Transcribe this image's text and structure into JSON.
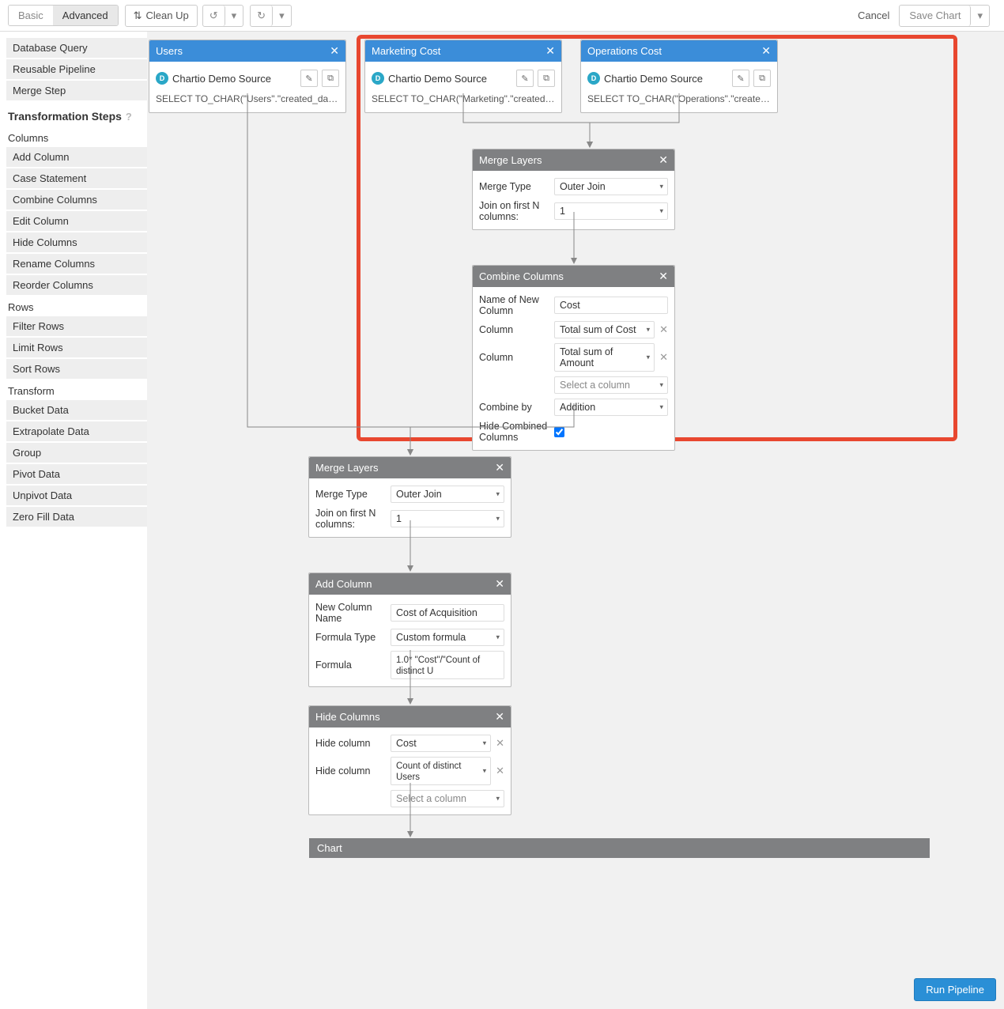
{
  "toolbar": {
    "basic": "Basic",
    "advanced": "Advanced",
    "cleanup": "Clean Up",
    "cancel": "Cancel",
    "save": "Save Chart"
  },
  "sidebar": {
    "top": [
      "Database Query",
      "Reusable Pipeline",
      "Merge Step"
    ],
    "header": "Transformation Steps",
    "columns_label": "Columns",
    "columns": [
      "Add Column",
      "Case Statement",
      "Combine Columns",
      "Edit Column",
      "Hide Columns",
      "Rename Columns",
      "Reorder Columns"
    ],
    "rows_label": "Rows",
    "rows": [
      "Filter Rows",
      "Limit Rows",
      "Sort Rows"
    ],
    "transform_label": "Transform",
    "transform": [
      "Bucket Data",
      "Extrapolate Data",
      "Group",
      "Pivot Data",
      "Unpivot Data",
      "Zero Fill Data"
    ]
  },
  "sources": {
    "users": {
      "title": "Users",
      "src": "Chartio Demo Source",
      "sql": "SELECT TO_CHAR(\"Users\".\"created_date\", 'YYYY-..."
    },
    "marketing": {
      "title": "Marketing Cost",
      "src": "Chartio Demo Source",
      "sql": "SELECT TO_CHAR(\"Marketing\".\"created_date\", 'YY..."
    },
    "operations": {
      "title": "Operations Cost",
      "src": "Chartio Demo Source",
      "sql": "SELECT TO_CHAR(\"Operations\".\"created_date\", 'Y..."
    }
  },
  "merge1": {
    "title": "Merge Layers",
    "type_label": "Merge Type",
    "type_value": "Outer Join",
    "join_label": "Join on first N columns:",
    "join_value": "1"
  },
  "combine": {
    "title": "Combine Columns",
    "name_label": "Name of New Column",
    "name_value": "Cost",
    "col_label": "Column",
    "col1": "Total sum of Cost",
    "col2": "Total sum of Amount",
    "col3": "Select a column",
    "by_label": "Combine by",
    "by_value": "Addition",
    "hide_label": "Hide Combined Columns"
  },
  "merge2": {
    "title": "Merge Layers",
    "type_label": "Merge Type",
    "type_value": "Outer Join",
    "join_label": "Join on first N columns:",
    "join_value": "1"
  },
  "addcol": {
    "title": "Add Column",
    "name_label": "New Column Name",
    "name_value": "Cost of Acquisition",
    "ftype_label": "Formula Type",
    "ftype_value": "Custom formula",
    "formula_label": "Formula",
    "formula_value": "1.0* \"Cost\"/\"Count of distinct U"
  },
  "hidecols": {
    "title": "Hide Columns",
    "label": "Hide column",
    "c1": "Cost",
    "c2": "Count of distinct Users",
    "c3": "Select a column"
  },
  "chart_label": "Chart",
  "run": "Run Pipeline"
}
